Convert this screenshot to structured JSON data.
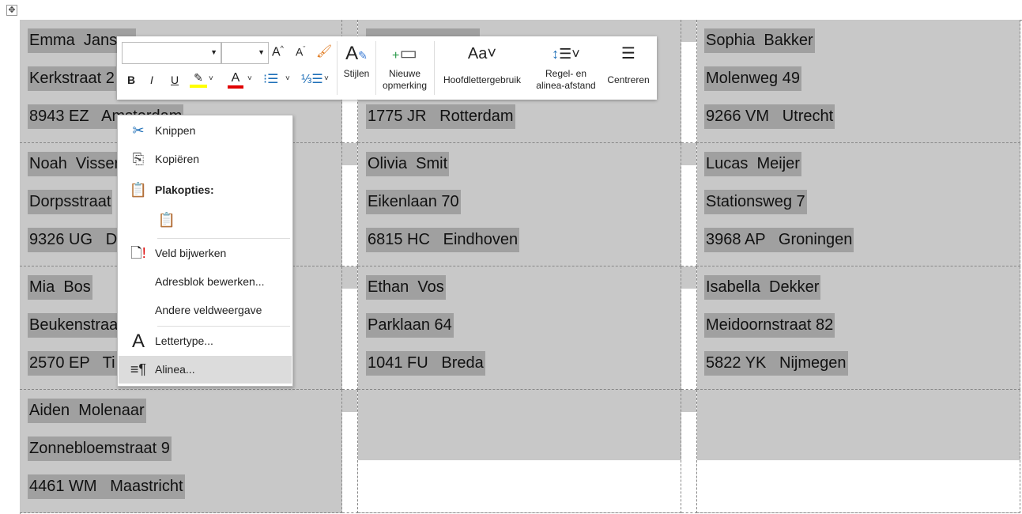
{
  "labels": [
    [
      "Emma  Jansen",
      "Kerkstraat 2",
      "8943 EZ   Amsterdam"
    ],
    [
      "",
      "",
      "1775 JR   Rotterdam"
    ],
    [
      "Sophia  Bakker",
      "Molenweg 49",
      "9266 VM   Utrecht"
    ],
    [
      "Noah  Visser",
      "Dorpsstraat",
      "9326 UG   D"
    ],
    [
      "Olivia  Smit",
      "Eikenlaan 70",
      "6815 HC   Eindhoven"
    ],
    [
      "Lucas  Meijer",
      "Stationsweg 7",
      "3968 AP   Groningen"
    ],
    [
      "Mia  Bos",
      "Beukenstraat",
      "2570 EP   Ti"
    ],
    [
      "Ethan  Vos",
      "Parklaan 64",
      "1041 FU   Breda"
    ],
    [
      "Isabella  Dekker",
      "Meidoornstraat 82",
      "5822 YK   Nijmegen"
    ],
    [
      "Aiden  Molenaar",
      "Zonnebloemstraat 9",
      "4461 WM   Maastricht"
    ]
  ],
  "toolbar": {
    "font_value": "",
    "size_value": "",
    "styles": "Stijlen",
    "new_comment_1": "Nieuwe",
    "new_comment_2": "opmerking",
    "case": "Hoofdlettergebruik",
    "spacing_1": "Regel- en",
    "spacing_2": "alinea-afstand",
    "center": "Centreren",
    "highlight_color": "#ffff00",
    "font_color": "#e00000"
  },
  "menu": {
    "cut": "Knippen",
    "copy": "Kopiëren",
    "paste_options": "Plakopties:",
    "update_field": "Veld bijwerken",
    "edit_address_block": "Adresblok bewerken...",
    "toggle_field": "Andere veldweergave",
    "font": "Lettertype...",
    "paragraph": "Alinea..."
  }
}
